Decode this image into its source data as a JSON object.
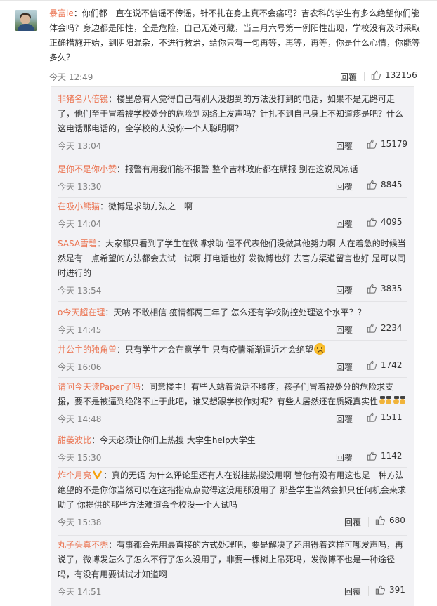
{
  "main_comment": {
    "username": "暴富le",
    "text": "：你们都一直在说不信谣不传谣，针不扎在身上真不会痛吗？吉农科的学生有多么绝望你们能体会吗？身边都是阳性，全是危险，自己无处可藏，当三月六号第一例阳性出现，学校没有及时采取正确措施开始，到阴阳混杂，不进行救治，给你只有一句再等，再等，再等，你是什么心情，你能等多久？",
    "time": "今天 12:49",
    "reply_label": "回覆",
    "likes": "132156"
  },
  "replies": [
    {
      "username": "非猪名八倍镜",
      "text": "：楼里总有人觉得自己有别人没想到的方法没打到的电话，如果不是无路可走了，他们至于冒着被学校处分的危险到网络上发声吗？针扎不到自己身上不知道疼是吧？什么这电话那电话的，全学校的人没你一个人聪明啊？",
      "time": "今天 13:04",
      "reply_label": "回覆",
      "likes": "15179"
    },
    {
      "username": "是你不是你小赞",
      "text": "：报警有用我们能不报警 整个吉林政府都在瞒报 别在这说风凉话",
      "time": "今天 13:30",
      "reply_label": "回覆",
      "likes": "8845"
    },
    {
      "username": "在吸小熊猫",
      "text": "：微博是求助方法之一啊",
      "time": "今天 14:04",
      "reply_label": "回覆",
      "likes": "4095"
    },
    {
      "username": "SASA雪碧",
      "text": "：大家都只看到了学生在微博求助 但不代表他们没做其他努力啊 人在着急的时候当然是有一点希望的方法都会去试一试啊 打电话也好 发微博也好 去官方渠道留言也好 是可以同时进行的",
      "time": "今天 13:54",
      "reply_label": "回覆",
      "likes": "3835"
    },
    {
      "username": "o今天超在理",
      "text": "：天呐 不敢相信 疫情都两三年了 怎么还有学校防控处理这个水平？？",
      "time": "今天 14:45",
      "reply_label": "回覆",
      "likes": "2234"
    },
    {
      "username": "井公主的独角兽",
      "text": "：只有学生才会在意学生 只有疫情渐渐逼近才会绝望",
      "time": "今天 16:06",
      "reply_label": "回覆",
      "likes": "1742"
    },
    {
      "username": "请问今天读Paper了吗",
      "text": "：同意楼主！有些人站着说话不腰疼，孩子们冒着被处分的危险求支援，要不是被逼到绝路不止于此吧，谁又想跟学校作对呢？有些人居然还在质疑真实性",
      "time": "今天 14:48",
      "reply_label": "回覆",
      "likes": "1511"
    },
    {
      "username": "甜萎波比",
      "text": "：今天必须让你们上热搜 大学生help大学生",
      "time": "今天 15:30",
      "reply_label": "回覆",
      "likes": "1142"
    },
    {
      "username": "炸个月亮",
      "text": "：真的无语 为什么评论里还有人在说挂热搜没用啊 管他有没有用这也是一种方法 绝望的不是你你当然可以在这指指点点觉得这没用那没用了 那些学生当然会抓只任何机会来求助了 你提供的那些方法难道会全校没一个人试吗",
      "time": "今天 15:38",
      "reply_label": "回覆",
      "likes": "680"
    },
    {
      "username": "丸子头真不秃",
      "text": "：有事都会先用最直接的方式处理吧，要是解决了还用得着这样可哪发声吗，再说了，微博发怎么了怎么不行了怎么没用了，非要一棵树上吊死吗，发微博不也是一种途径吗，有没有用要试试才知道啊",
      "time": "今天 14:51",
      "reply_label": "回覆",
      "likes": "391"
    }
  ],
  "colors": {
    "username": "#eb7350",
    "reply_bg": "#f2f2f5",
    "text": "#333333",
    "meta": "#808080"
  }
}
